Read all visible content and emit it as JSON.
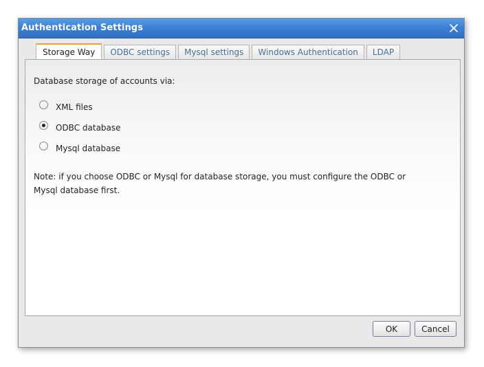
{
  "dialog": {
    "title": "Authentication Settings"
  },
  "tabs": [
    {
      "label": "Storage Way",
      "active": true
    },
    {
      "label": "ODBC settings",
      "active": false
    },
    {
      "label": "Mysql settings",
      "active": false
    },
    {
      "label": "Windows Authentication",
      "active": false
    },
    {
      "label": "LDAP",
      "active": false
    }
  ],
  "storage": {
    "heading": "Database storage of accounts via:",
    "options": [
      {
        "label": "XML files",
        "checked": false
      },
      {
        "label": "ODBC database",
        "checked": true
      },
      {
        "label": "Mysql database",
        "checked": false
      }
    ],
    "note": "Note: if you choose ODBC or Mysql for database storage, you must configure the ODBC or Mysql database first."
  },
  "buttons": {
    "ok": "OK",
    "cancel": "Cancel"
  },
  "icons": {
    "close": "close-icon"
  },
  "colors": {
    "titlebar": "#3b80d4",
    "active_tab_accent": "#f0a030",
    "tab_text": "#4a6f96"
  }
}
